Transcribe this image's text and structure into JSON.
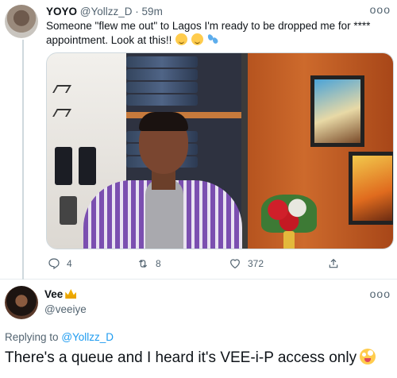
{
  "tweet1": {
    "author_name": "YOYO",
    "handle": "@Yollzz_D",
    "separator": "·",
    "time": "59m",
    "more": "ooo",
    "text": "Someone \"flew me out\" to Lagos I'm ready to be dropped me for **** appointment. Look at this!!",
    "emojis": [
      "relieved-face",
      "relieved-face",
      "sweat-droplets"
    ],
    "stats": {
      "replies": "4",
      "retweets": "8",
      "likes": "372"
    }
  },
  "tweet2": {
    "author_name": "Vee",
    "name_emoji": "crown",
    "handle": "@veeiye",
    "more": "ooo",
    "replying_prefix": "Replying to",
    "replying_handle": "@Yollzz_D",
    "text": "There's a queue and I heard it's VEE-i-P access only",
    "trailing_emoji": "zany-face"
  },
  "colors": {
    "link": "#1d9bf0",
    "secondary_text": "#536471",
    "border": "#e6ecf0"
  }
}
